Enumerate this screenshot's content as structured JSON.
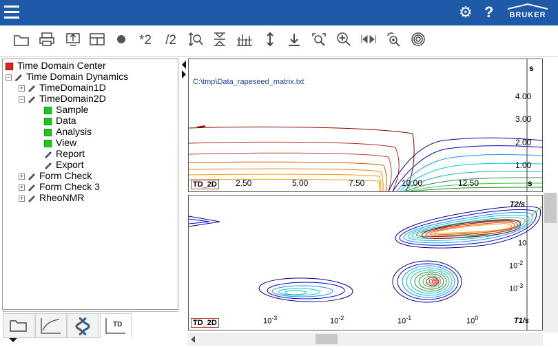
{
  "toolbar": {
    "multiply_label": "*2",
    "divide_label": "/2"
  },
  "tree": {
    "root": "Time Domain Center",
    "dynamics": "Time Domain Dynamics",
    "td1": "TimeDomain1D",
    "td2": "TimeDomain2D",
    "sample": "Sample",
    "data": "Data",
    "analysis": "Analysis",
    "view": "View",
    "report": "Report",
    "export": "Export",
    "form_check": "Form Check",
    "form_check3": "Form Check 3",
    "rheonmr": "RheoNMR"
  },
  "tabs": {
    "td_label": "TD"
  },
  "top_plot": {
    "file": "C:\\tmp\\Data_rapeseed_matrix.txt",
    "tag": "TD_2D",
    "x_unit": "s",
    "y_unit": "s",
    "x_ticks": [
      "2.50",
      "5.00",
      "7.50",
      "10.00",
      "12.50"
    ],
    "y_ticks": [
      "4.00",
      "3.00",
      "2.00",
      "1.00"
    ]
  },
  "bottom_plot": {
    "tag": "TD_2D",
    "x_label": "T1/s",
    "y_label": "T2/s",
    "x_ticks": [
      "10",
      "10",
      "10",
      "10"
    ],
    "x_exp": [
      "-3",
      "-2",
      "-1",
      "0"
    ],
    "y_ticks": [
      "10",
      "10",
      "10"
    ],
    "y_exp": [
      "",
      "-2",
      "-3"
    ]
  },
  "brand": "BRUKER",
  "colors": {
    "topbar": "#1e5aa8",
    "green": "#1ec71e"
  }
}
